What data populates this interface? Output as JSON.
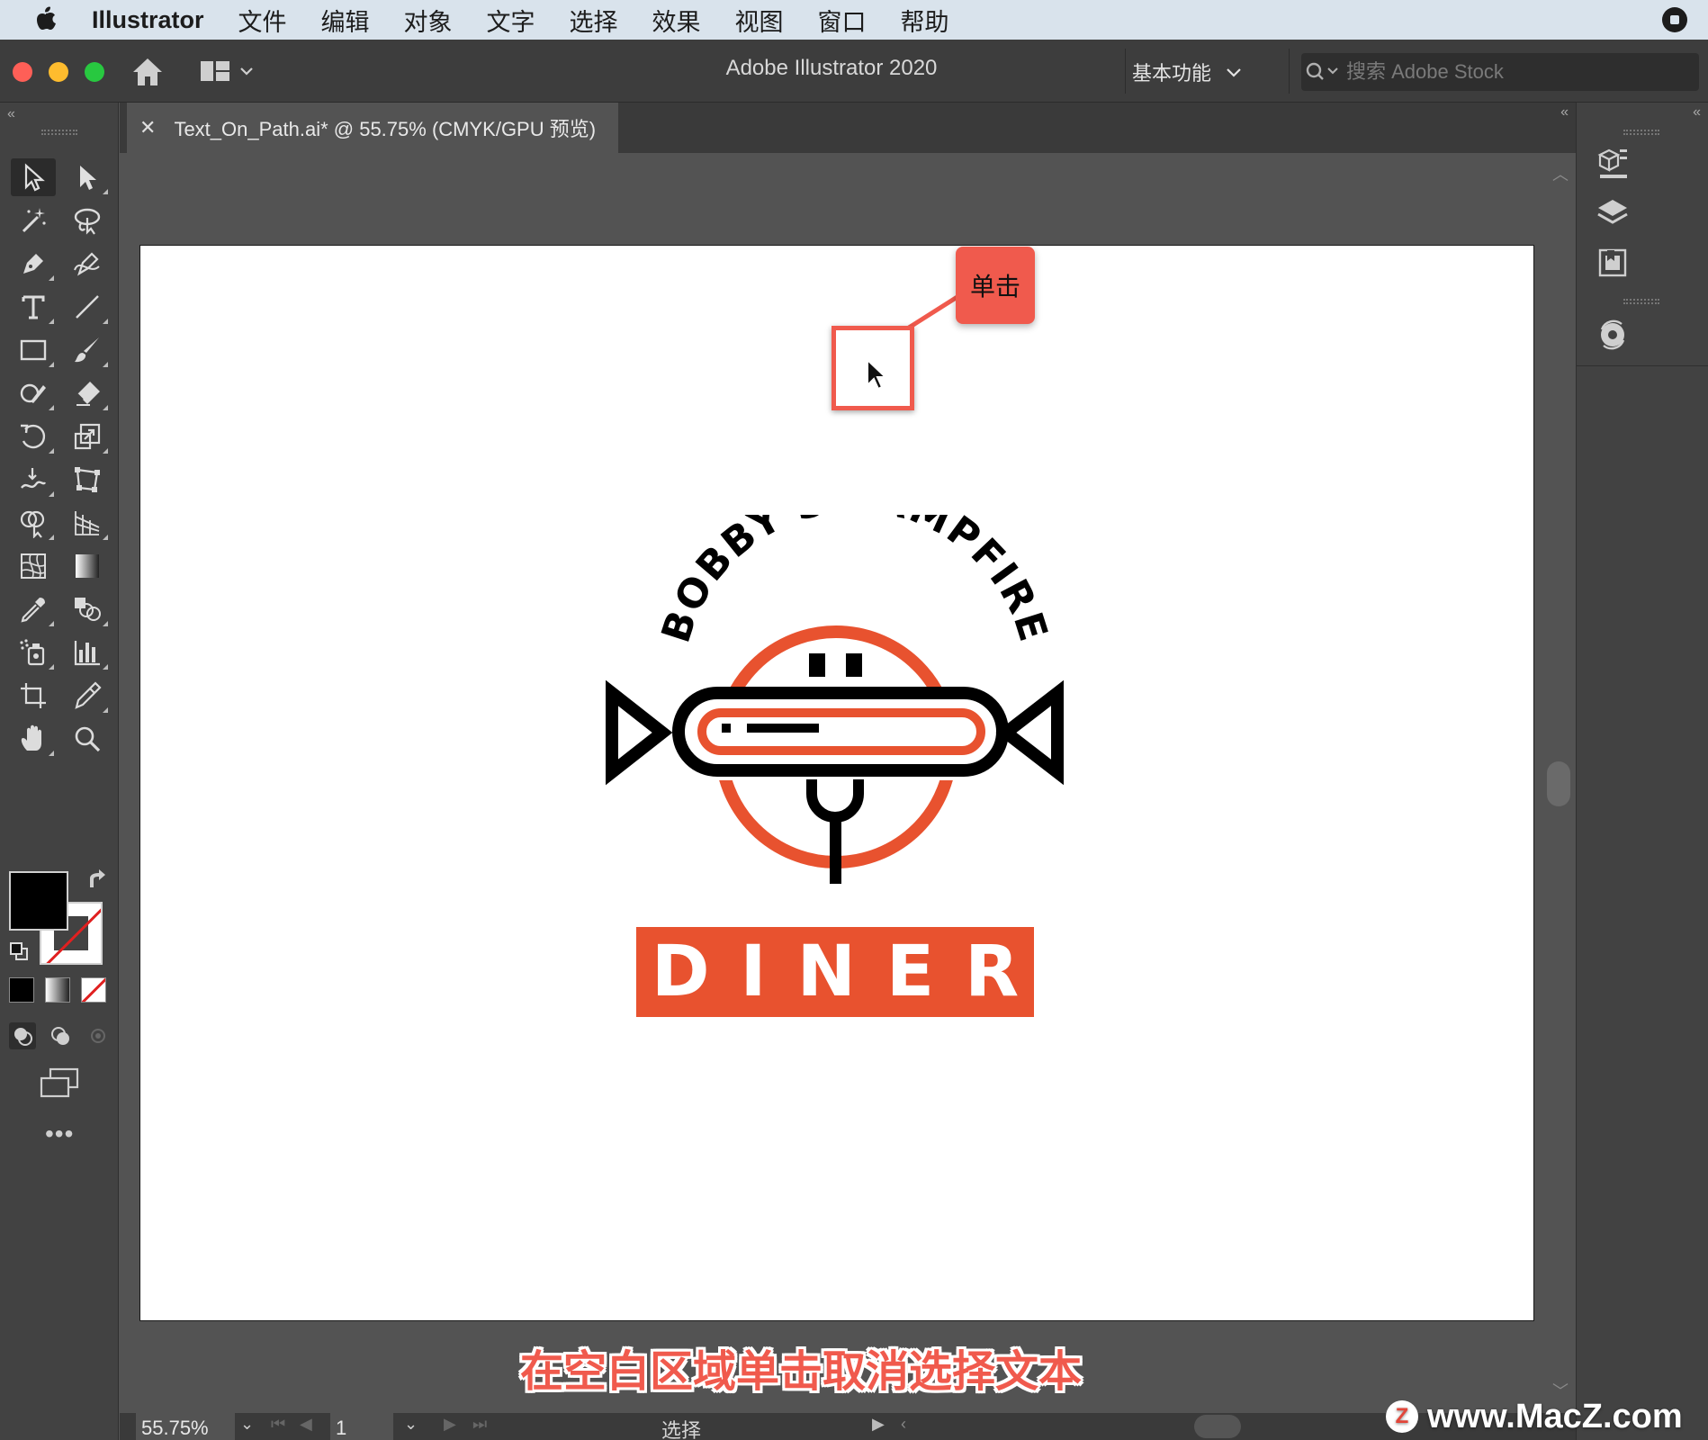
{
  "menubar": {
    "app_name": "Illustrator",
    "items": [
      "文件",
      "编辑",
      "对象",
      "文字",
      "选择",
      "效果",
      "视图",
      "窗口",
      "帮助"
    ]
  },
  "titlebar": {
    "title": "Adobe Illustrator 2020",
    "workspace": "基本功能",
    "search_placeholder": "搜索 Adobe Stock"
  },
  "document": {
    "tab_title": "Text_On_Path.ai* @ 55.75% (CMYK/GPU 预览)"
  },
  "statusbar": {
    "zoom": "55.75%",
    "page": "1",
    "tool_label": "选择"
  },
  "artwork": {
    "arc_text": "BOBBY'S CAMPFIRE",
    "banner_text": "DINER",
    "accent_color": "#e8522f",
    "ink_color": "#000000"
  },
  "annotation": {
    "callout": "单击",
    "caption": "在空白区域单击取消选择文本",
    "color": "#f05a4d"
  },
  "watermark": {
    "logo_letter": "Z",
    "text": "www.MacZ.com"
  },
  "icons": [
    "apple-icon",
    "home-icon",
    "workspace-layout-icon",
    "search-icon",
    "selection-tool-icon",
    "direct-selection-tool-icon",
    "magic-wand-icon",
    "lasso-icon",
    "pen-tool-icon",
    "curvature-tool-icon",
    "type-tool-icon",
    "line-tool-icon",
    "rectangle-tool-icon",
    "paintbrush-icon",
    "shaper-tool-icon",
    "eraser-icon",
    "rotate-tool-icon",
    "scale-tool-icon",
    "warp-tool-icon",
    "free-transform-icon",
    "shape-builder-icon",
    "perspective-grid-icon",
    "mesh-tool-icon",
    "gradient-tool-icon",
    "eyedropper-icon",
    "blend-tool-icon",
    "symbol-sprayer-icon",
    "column-graph-icon",
    "artboard-tool-icon",
    "slice-tool-icon",
    "hand-tool-icon",
    "zoom-tool-icon",
    "properties-panel-icon",
    "layers-panel-icon",
    "libraries-panel-icon",
    "cc-sync-icon"
  ]
}
